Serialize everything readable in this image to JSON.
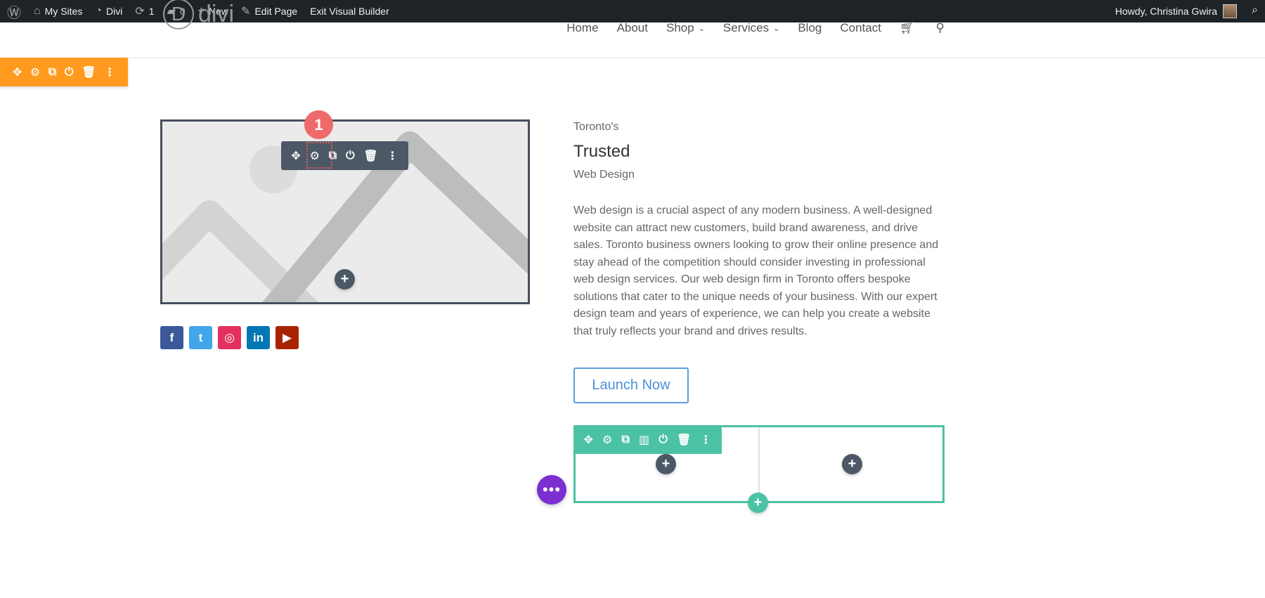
{
  "adminbar": {
    "items": [
      {
        "icon": "wordpress-icon",
        "label": ""
      },
      {
        "icon": "my-sites-icon",
        "label": "My Sites"
      },
      {
        "icon": "dashboard-icon",
        "label": "Divi"
      },
      {
        "icon": "updates-icon",
        "label": "1"
      },
      {
        "icon": "comments-icon",
        "label": "0"
      },
      {
        "icon": "plus-icon",
        "label": "New"
      },
      {
        "icon": "pencil-icon",
        "label": "Edit Page"
      },
      {
        "icon": "",
        "label": "Exit Visual Builder"
      }
    ],
    "howdy": "Howdy, Christina Gwira"
  },
  "logo": {
    "letter": "D",
    "text": "divi"
  },
  "nav": [
    "Home",
    "About",
    "Shop",
    "Services",
    "Blog",
    "Contact"
  ],
  "badge": "1",
  "content": {
    "kicker": "Toronto's",
    "title": "Trusted",
    "subtitle": "Web Design",
    "paragraph": "Web design is a crucial aspect of any modern business. A well-designed website can attract new customers, build brand awareness, and drive sales. Toronto business owners looking to grow their online presence and stay ahead of the competition should consider investing in professional web design services. Our web design firm in Toronto offers bespoke solutions that cater to the unique needs of your business. With our expert design team and years of experience, we can help you create a website that truly reflects your brand and drives results.",
    "button": "Launch Now"
  },
  "social": [
    {
      "name": "facebook",
      "glyph": "f",
      "color": "#3b5998"
    },
    {
      "name": "twitter",
      "glyph": "t",
      "color": "#41a6ea"
    },
    {
      "name": "instagram",
      "glyph": "◎",
      "color": "#e4305e"
    },
    {
      "name": "linkedin",
      "glyph": "in",
      "color": "#0077b5"
    },
    {
      "name": "youtube",
      "glyph": "▶",
      "color": "#a82400"
    }
  ],
  "colors": {
    "section": "#ff9a1e",
    "module": "#4c5866",
    "row": "#4cc2a4",
    "badge": "#ef6a6a",
    "fab": "#7b2fd1"
  }
}
